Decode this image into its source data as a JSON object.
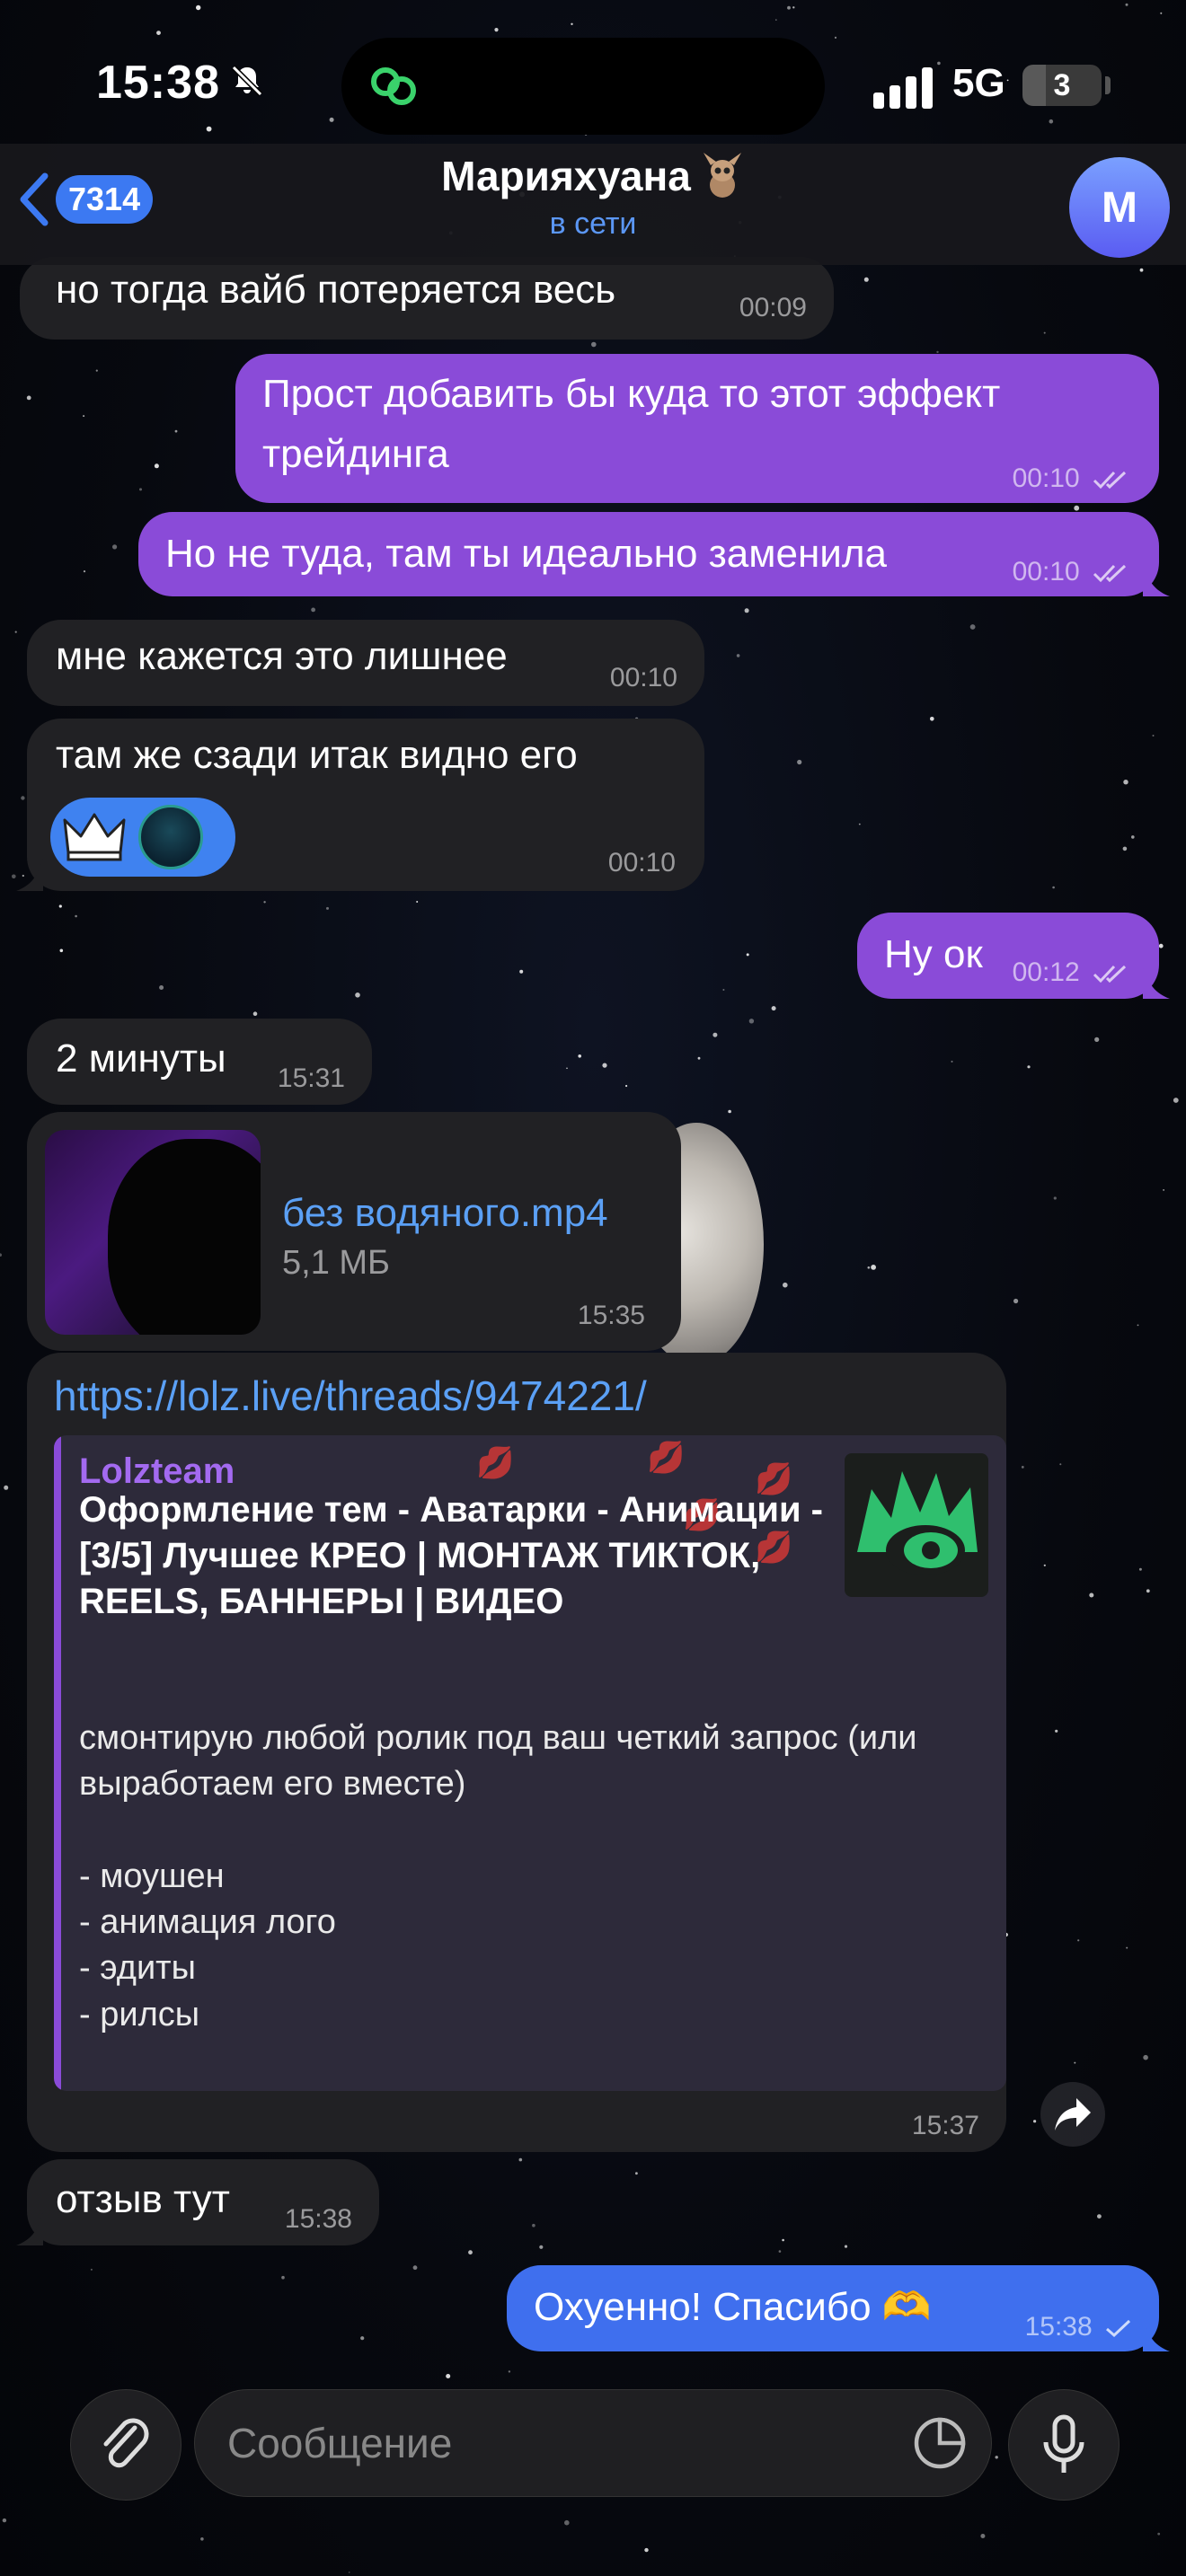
{
  "status": {
    "time": "15:38",
    "network": "5G",
    "battery": "3",
    "battery_level": 0.3
  },
  "header": {
    "back_count": "7314",
    "title": "Марияхуана",
    "subtitle": "в сети",
    "avatar_letter": "М"
  },
  "messages": [
    {
      "dir": "in",
      "text": "но тогда вайб потеряется весь",
      "time": "00:09"
    },
    {
      "dir": "out",
      "text": "Прост добавить бы куда то этот эффект трейдинга",
      "time": "00:10",
      "read": true
    },
    {
      "dir": "out",
      "text": "Но не туда, там ты идеально заменила",
      "time": "00:10",
      "read": true
    },
    {
      "dir": "in",
      "text": "мне кажется это лишнее",
      "time": "00:10"
    },
    {
      "dir": "in",
      "text": "там же сзади итак видно его",
      "time": "00:10"
    },
    {
      "dir": "out",
      "text": "Ну ок",
      "time": "00:12",
      "read": true
    },
    {
      "dir": "in",
      "text": "2 минуты",
      "time": "15:31"
    },
    {
      "dir": "in",
      "type": "file",
      "file_name": "без водяного.mp4",
      "file_size": "5,1 МБ",
      "time": "15:35"
    },
    {
      "dir": "in",
      "type": "link",
      "url": "https://lolz.live/threads/9474221/",
      "preview_site": "Lolzteam",
      "preview_title": "Оформление тем - Аватарки - Анимации - [3/5] Лучшее КРЕО | МОНТАЖ ТИКТОК, REELS, БАННЕРЫ | ВИДЕО",
      "preview_desc": "смонтирую любой ролик под ваш четкий запрос (или выработаем его вместе)\n\n- моушен\n- анимация лого\n- эдиты\n- рилсы\n\nдля выполнения работы мне требуется...",
      "time": "15:37"
    },
    {
      "dir": "in",
      "text": "отзыв тут",
      "time": "15:38"
    },
    {
      "dir": "out",
      "text": "Охуенно! Спасибо 🫶",
      "time": "15:38",
      "read": false
    }
  ],
  "composer": {
    "placeholder": "Сообщение"
  },
  "colors": {
    "outgoing_purple": "#8a4bd8",
    "outgoing_blue": "#3f6fee",
    "incoming": "#212124",
    "accent": "#3c79f2",
    "link": "#5ba0f5"
  },
  "icons": [
    "bell-slash-icon",
    "link-icon",
    "signal-icon",
    "chevron-left-icon",
    "crown-icon",
    "share-icon",
    "paperclip-icon",
    "sticker-icon",
    "microphone-icon",
    "double-check-icon",
    "check-icon"
  ]
}
